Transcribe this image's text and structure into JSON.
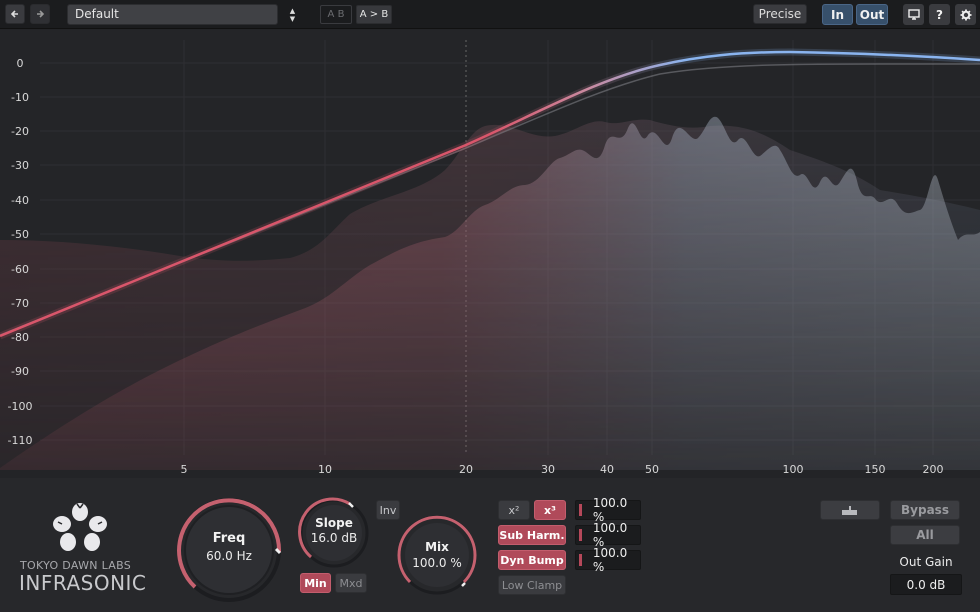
{
  "toolbar": {
    "back_icon": "arrow-left-icon",
    "forward_icon": "arrow-right-icon",
    "preset_name": "Default",
    "ab_label": "A B",
    "ab_copy_label": "A > B",
    "precise_label": "Precise",
    "in_label": "In",
    "out_label": "Out",
    "display_icon": "monitor-icon",
    "help_label": "?",
    "settings_icon": "gear-icon"
  },
  "graph": {
    "db_labels": [
      "0",
      "-10",
      "-20",
      "-30",
      "-40",
      "-50",
      "-60",
      "-70",
      "-80",
      "-90",
      "-100",
      "-110"
    ],
    "hz_labels": [
      "5",
      "10",
      "20",
      "30",
      "40",
      "50",
      "100",
      "150",
      "200"
    ],
    "colors": {
      "filter_low": "#d9566b",
      "filter_high": "#8ab4ef",
      "spectrum_low": "#d9707f",
      "spectrum_high": "#c8d3e6"
    }
  },
  "logo": {
    "company": "TOKYO DAWN LABS",
    "product": "INFRASONIC",
    "icon": "flower-logo-icon"
  },
  "controls": {
    "freq": {
      "title": "Freq",
      "value": "60.0 Hz"
    },
    "slope": {
      "title": "Slope",
      "value": "16.0 dB"
    },
    "inv_label": "Inv",
    "min_label": "Min",
    "mxd_label": "Mxd",
    "mix": {
      "title": "Mix",
      "value": "100.0 %"
    },
    "x2_label": "x²",
    "x3_label": "x³",
    "sub_harm_label": "Sub Harm.",
    "dyn_bump_label": "Dyn Bump",
    "low_clamp_label": "Low Clamp",
    "pct_values": [
      "100.0 %",
      "100.0 %",
      "100.0 %"
    ]
  },
  "right": {
    "listen_icon": "hand-pointer-icon",
    "bypass_label": "Bypass",
    "all_label": "All",
    "out_gain_label": "Out Gain",
    "out_gain_value": "0.0 dB"
  }
}
